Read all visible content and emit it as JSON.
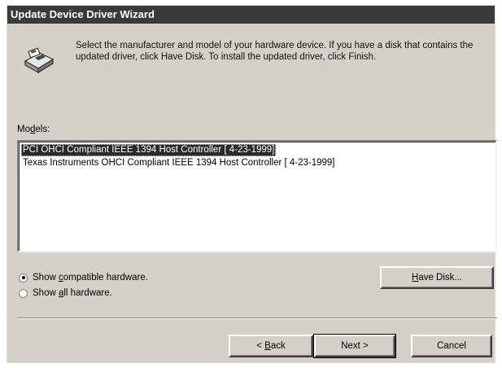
{
  "window": {
    "title": "Update Device Driver Wizard"
  },
  "header": {
    "icon": "install-disk-icon",
    "instructions": "Select the manufacturer and model of your hardware device. If you have a disk that contains the updated driver, click Have Disk. To install the updated driver, click Finish."
  },
  "models": {
    "label": "Models:",
    "items": [
      {
        "label": "PCI OHCI Compliant IEEE 1394 Host Controller [ 4-23-1999]",
        "selected": true
      },
      {
        "label": "Texas Instruments OHCI Compliant IEEE 1394 Host Controller [ 4-23-1999]",
        "selected": false
      }
    ]
  },
  "options": {
    "show_compatible": {
      "label": "Show compatible hardware.",
      "checked": true
    },
    "show_all": {
      "label": "Show all hardware.",
      "checked": false
    }
  },
  "buttons": {
    "have_disk": "Have Disk...",
    "back": "< Back",
    "next": "Next >",
    "cancel": "Cancel"
  }
}
